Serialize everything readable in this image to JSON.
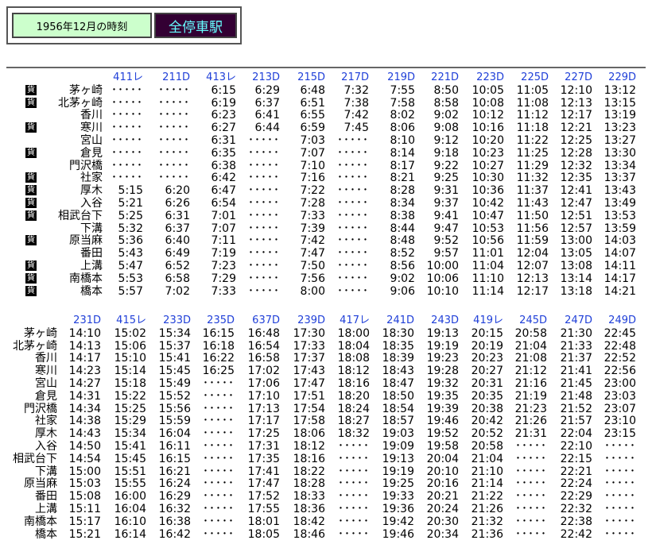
{
  "header": {
    "date_label": "1956年12月の時刻",
    "button_label": "全停車駅"
  },
  "freight_label": "貨",
  "block1": {
    "trains": [
      "411レ",
      "211D",
      "413レ",
      "213D",
      "215D",
      "217D",
      "219D",
      "221D",
      "223D",
      "225D",
      "227D",
      "229D"
    ],
    "rows": [
      {
        "station": "茅ヶ崎",
        "freight": true,
        "times": [
          "･････",
          "･････",
          "6:15",
          "6:29",
          "6:48",
          "7:32",
          "7:55",
          "8:50",
          "10:05",
          "11:05",
          "12:10",
          "13:12"
        ]
      },
      {
        "station": "北茅ヶ崎",
        "freight": true,
        "times": [
          "･････",
          "･････",
          "6:19",
          "6:37",
          "6:51",
          "7:38",
          "7:58",
          "8:58",
          "10:08",
          "11:08",
          "12:13",
          "13:15"
        ]
      },
      {
        "station": "香川",
        "freight": false,
        "times": [
          "･････",
          "･････",
          "6:23",
          "6:41",
          "6:55",
          "7:42",
          "8:02",
          "9:02",
          "10:12",
          "11:12",
          "12:17",
          "13:19"
        ]
      },
      {
        "station": "寒川",
        "freight": true,
        "times": [
          "･････",
          "･････",
          "6:27",
          "6:44",
          "6:59",
          "7:45",
          "8:06",
          "9:08",
          "10:16",
          "11:18",
          "12:21",
          "13:23"
        ]
      },
      {
        "station": "宮山",
        "freight": false,
        "times": [
          "･････",
          "･････",
          "6:31",
          "･････",
          "7:03",
          "･････",
          "8:10",
          "9:12",
          "10:20",
          "11:22",
          "12:25",
          "13:27"
        ]
      },
      {
        "station": "倉見",
        "freight": true,
        "times": [
          "･････",
          "･････",
          "6:35",
          "･････",
          "7:07",
          "･････",
          "8:14",
          "9:18",
          "10:23",
          "11:25",
          "12:28",
          "13:30"
        ]
      },
      {
        "station": "門沢橋",
        "freight": false,
        "times": [
          "･････",
          "･････",
          "6:38",
          "･････",
          "7:10",
          "･････",
          "8:17",
          "9:22",
          "10:27",
          "11:29",
          "12:32",
          "13:34"
        ]
      },
      {
        "station": "社家",
        "freight": true,
        "times": [
          "･････",
          "･････",
          "6:42",
          "･････",
          "7:16",
          "･････",
          "8:21",
          "9:25",
          "10:30",
          "11:32",
          "12:35",
          "13:37"
        ]
      },
      {
        "station": "厚木",
        "freight": true,
        "times": [
          "5:15",
          "6:20",
          "6:47",
          "･････",
          "7:22",
          "･････",
          "8:28",
          "9:31",
          "10:36",
          "11:37",
          "12:41",
          "13:43"
        ]
      },
      {
        "station": "入谷",
        "freight": true,
        "times": [
          "5:21",
          "6:26",
          "6:54",
          "･････",
          "7:28",
          "･････",
          "8:34",
          "9:37",
          "10:42",
          "11:43",
          "12:47",
          "13:49"
        ]
      },
      {
        "station": "相武台下",
        "freight": true,
        "times": [
          "5:25",
          "6:31",
          "7:01",
          "･････",
          "7:33",
          "･････",
          "8:38",
          "9:41",
          "10:47",
          "11:50",
          "12:51",
          "13:53"
        ]
      },
      {
        "station": "下溝",
        "freight": false,
        "times": [
          "5:32",
          "6:37",
          "7:07",
          "･････",
          "7:39",
          "･････",
          "8:44",
          "9:47",
          "10:53",
          "11:56",
          "12:57",
          "13:59"
        ]
      },
      {
        "station": "原当麻",
        "freight": true,
        "times": [
          "5:36",
          "6:40",
          "7:11",
          "･････",
          "7:42",
          "･････",
          "8:48",
          "9:52",
          "10:56",
          "11:59",
          "13:00",
          "14:03"
        ]
      },
      {
        "station": "番田",
        "freight": false,
        "times": [
          "5:43",
          "6:49",
          "7:19",
          "･････",
          "7:47",
          "･････",
          "8:52",
          "9:57",
          "11:01",
          "12:04",
          "13:05",
          "14:07"
        ]
      },
      {
        "station": "上溝",
        "freight": true,
        "times": [
          "5:47",
          "6:52",
          "7:23",
          "･････",
          "7:50",
          "･････",
          "8:56",
          "10:00",
          "11:04",
          "12:07",
          "13:08",
          "14:11"
        ]
      },
      {
        "station": "南橋本",
        "freight": true,
        "times": [
          "5:53",
          "6:58",
          "7:29",
          "･････",
          "7:56",
          "･････",
          "9:02",
          "10:06",
          "11:10",
          "12:13",
          "13:14",
          "14:17"
        ]
      },
      {
        "station": "橋本",
        "freight": true,
        "times": [
          "5:57",
          "7:02",
          "7:33",
          "･････",
          "8:00",
          "･････",
          "9:06",
          "10:10",
          "11:14",
          "12:17",
          "13:18",
          "14:21"
        ]
      }
    ]
  },
  "block2": {
    "trains": [
      "231D",
      "415レ",
      "233D",
      "235D",
      "637D",
      "239D",
      "417レ",
      "241D",
      "243D",
      "419レ",
      "245D",
      "247D",
      "249D"
    ],
    "rows": [
      {
        "station": "茅ヶ崎",
        "times": [
          "14:10",
          "15:02",
          "15:34",
          "16:15",
          "16:48",
          "17:30",
          "18:00",
          "18:30",
          "19:13",
          "20:15",
          "20:58",
          "21:30",
          "22:45"
        ]
      },
      {
        "station": "北茅ヶ崎",
        "times": [
          "14:13",
          "15:06",
          "15:37",
          "16:18",
          "16:54",
          "17:33",
          "18:04",
          "18:35",
          "19:19",
          "20:19",
          "21:04",
          "21:33",
          "22:48"
        ]
      },
      {
        "station": "香川",
        "times": [
          "14:17",
          "15:10",
          "15:41",
          "16:22",
          "16:58",
          "17:37",
          "18:08",
          "18:39",
          "19:23",
          "20:23",
          "21:08",
          "21:37",
          "22:52"
        ]
      },
      {
        "station": "寒川",
        "times": [
          "14:23",
          "15:14",
          "15:45",
          "16:25",
          "17:02",
          "17:43",
          "18:12",
          "18:43",
          "19:28",
          "20:27",
          "21:12",
          "21:41",
          "22:56"
        ]
      },
      {
        "station": "宮山",
        "times": [
          "14:27",
          "15:18",
          "15:49",
          "･････",
          "17:06",
          "17:47",
          "18:16",
          "18:47",
          "19:32",
          "20:31",
          "21:16",
          "21:45",
          "23:00"
        ]
      },
      {
        "station": "倉見",
        "times": [
          "14:31",
          "15:22",
          "15:52",
          "･････",
          "17:10",
          "17:51",
          "18:20",
          "18:50",
          "19:35",
          "20:35",
          "21:19",
          "21:48",
          "23:03"
        ]
      },
      {
        "station": "門沢橋",
        "times": [
          "14:34",
          "15:25",
          "15:56",
          "･････",
          "17:13",
          "17:54",
          "18:24",
          "18:54",
          "19:39",
          "20:38",
          "21:23",
          "21:52",
          "23:07"
        ]
      },
      {
        "station": "社家",
        "times": [
          "14:38",
          "15:29",
          "15:59",
          "･････",
          "17:17",
          "17:58",
          "18:27",
          "18:57",
          "19:46",
          "20:42",
          "21:26",
          "21:57",
          "23:10"
        ]
      },
      {
        "station": "厚木",
        "times": [
          "14:43",
          "15:34",
          "16:04",
          "･････",
          "17:25",
          "18:06",
          "18:32",
          "19:03",
          "19:52",
          "20:52",
          "21:31",
          "22:04",
          "23:15"
        ]
      },
      {
        "station": "入谷",
        "times": [
          "14:50",
          "15:41",
          "16:11",
          "･････",
          "17:31",
          "18:12",
          "･････",
          "19:09",
          "19:58",
          "20:58",
          "･････",
          "22:10",
          "･････"
        ]
      },
      {
        "station": "相武台下",
        "times": [
          "14:54",
          "15:45",
          "16:15",
          "･････",
          "17:35",
          "18:16",
          "･････",
          "19:13",
          "20:04",
          "21:04",
          "･････",
          "22:15",
          "･････"
        ]
      },
      {
        "station": "下溝",
        "times": [
          "15:00",
          "15:51",
          "16:21",
          "･････",
          "17:41",
          "18:22",
          "･････",
          "19:19",
          "20:10",
          "21:10",
          "･････",
          "22:21",
          "･････"
        ]
      },
      {
        "station": "原当麻",
        "times": [
          "15:03",
          "15:55",
          "16:24",
          "･････",
          "17:47",
          "18:28",
          "･････",
          "19:25",
          "20:16",
          "21:14",
          "･････",
          "22:24",
          "･････"
        ]
      },
      {
        "station": "番田",
        "times": [
          "15:08",
          "16:00",
          "16:29",
          "･････",
          "17:52",
          "18:33",
          "･････",
          "19:33",
          "20:21",
          "21:22",
          "･････",
          "22:29",
          "･････"
        ]
      },
      {
        "station": "上溝",
        "times": [
          "15:11",
          "16:04",
          "16:32",
          "･････",
          "17:55",
          "18:36",
          "･････",
          "19:36",
          "20:24",
          "21:26",
          "･････",
          "22:32",
          "･････"
        ]
      },
      {
        "station": "南橋本",
        "times": [
          "15:17",
          "16:10",
          "16:38",
          "･････",
          "18:01",
          "18:42",
          "･････",
          "19:42",
          "20:30",
          "21:32",
          "･････",
          "22:38",
          "･････"
        ]
      },
      {
        "station": "橋本",
        "times": [
          "15:21",
          "16:14",
          "16:42",
          "･････",
          "18:05",
          "18:46",
          "･････",
          "19:46",
          "20:34",
          "21:36",
          "･････",
          "22:42",
          "･････"
        ]
      }
    ]
  }
}
